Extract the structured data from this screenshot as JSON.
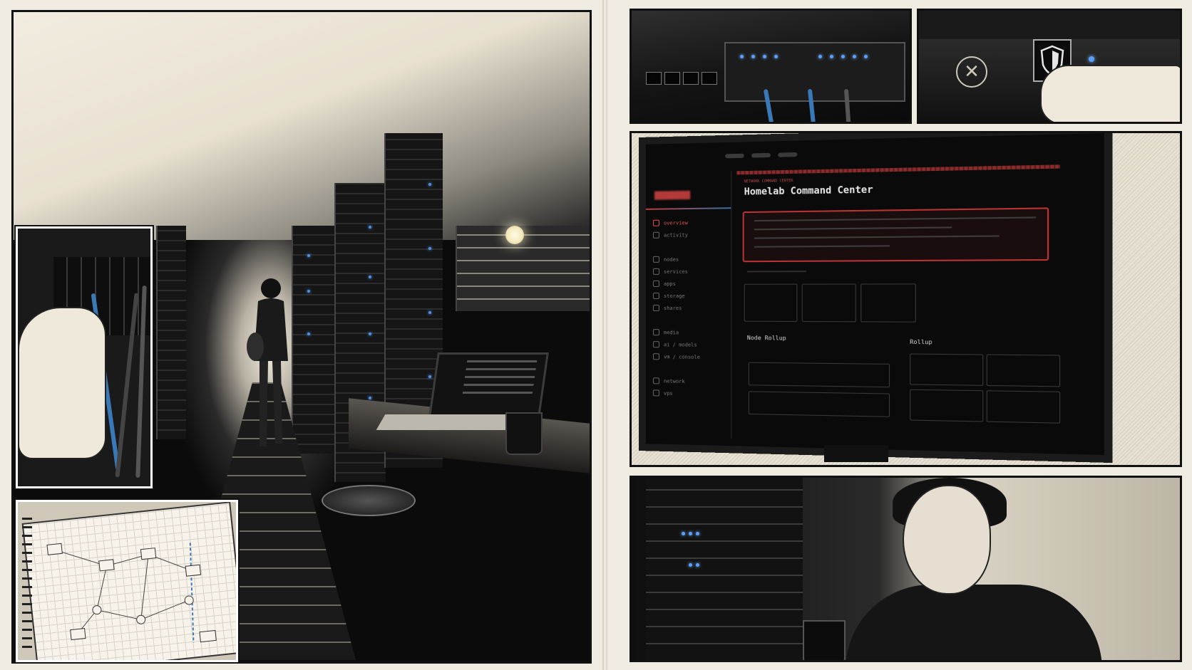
{
  "screen_ui": {
    "eyebrow": "NETWORK COMMAND CENTER",
    "title": "Homelab Command Center",
    "nav": [
      {
        "label": "overview",
        "active": true
      },
      {
        "label": "activity"
      },
      {
        "label": "nodes"
      },
      {
        "label": "services"
      },
      {
        "label": "apps"
      },
      {
        "label": "storage"
      },
      {
        "label": "shares"
      },
      {
        "label": "media"
      },
      {
        "label": "ai / models"
      },
      {
        "label": "vm / console"
      },
      {
        "label": "network"
      },
      {
        "label": "vps"
      }
    ],
    "sections": {
      "node_rollup": "Node Rollup",
      "rollup": "Rollup"
    }
  },
  "colors": {
    "accent_red": "#b83434",
    "led_blue": "#5aa0ff",
    "paper": "#f1ece1",
    "ink": "#111111"
  },
  "icons": [
    "close-x-icon",
    "shield-icon"
  ]
}
